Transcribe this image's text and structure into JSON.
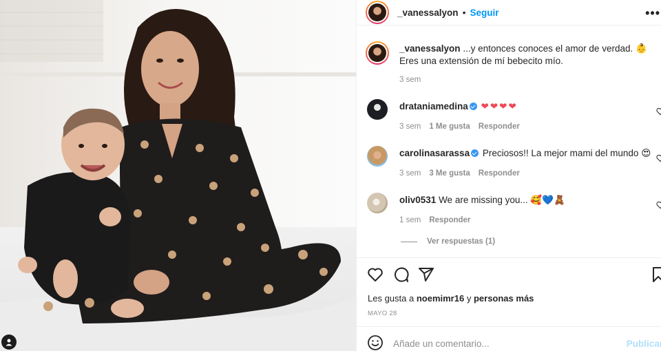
{
  "post": {
    "author": "_vanessalyon",
    "follow_label": "Seguir",
    "more_label": "•••",
    "caption_user": "_vanessalyon",
    "caption_text": "...y entonces conoces el amor de verdad.",
    "caption_text_2": "Eres una extensión de mí bebecito mío.",
    "caption_emoji": "👶",
    "caption_time": "3 sem"
  },
  "comments": [
    {
      "user": "drataniamedina",
      "verified": true,
      "text": "❤❤❤❤",
      "time": "3 sem",
      "likes": "1 Me gusta",
      "reply": "Responder"
    },
    {
      "user": "carolinasarassa",
      "verified": true,
      "text": "Preciosos!! La mejor mami del mundo",
      "emoji": "😍",
      "time": "3 sem",
      "likes": "3 Me gusta",
      "reply": "Responder"
    },
    {
      "user": "oliv0531",
      "verified": false,
      "text": "We are missing you...",
      "emoji": "🥰💙🧸",
      "time": "1 sem",
      "reply": "Responder"
    }
  ],
  "view_replies": "Ver respuestas (1)",
  "actions": {
    "likes_prefix": "Les gusta a",
    "likes_user": "noemimr16",
    "likes_mid": "y",
    "likes_suffix": "personas más",
    "date": "MAYO 28"
  },
  "composer": {
    "placeholder": "Añade un comentario...",
    "publish": "Publicar"
  },
  "icons": [
    "heart-icon",
    "comment-icon",
    "share-icon",
    "bookmark-icon",
    "emoji-icon",
    "user-tag-icon",
    "more-icon",
    "verified-icon"
  ],
  "colors": {
    "follow": "#0095f6",
    "muted": "#8e8e8e",
    "text": "#262626",
    "publish_disabled": "#b2dffc",
    "verified": "#3897f0",
    "heart": "#ed4956"
  }
}
